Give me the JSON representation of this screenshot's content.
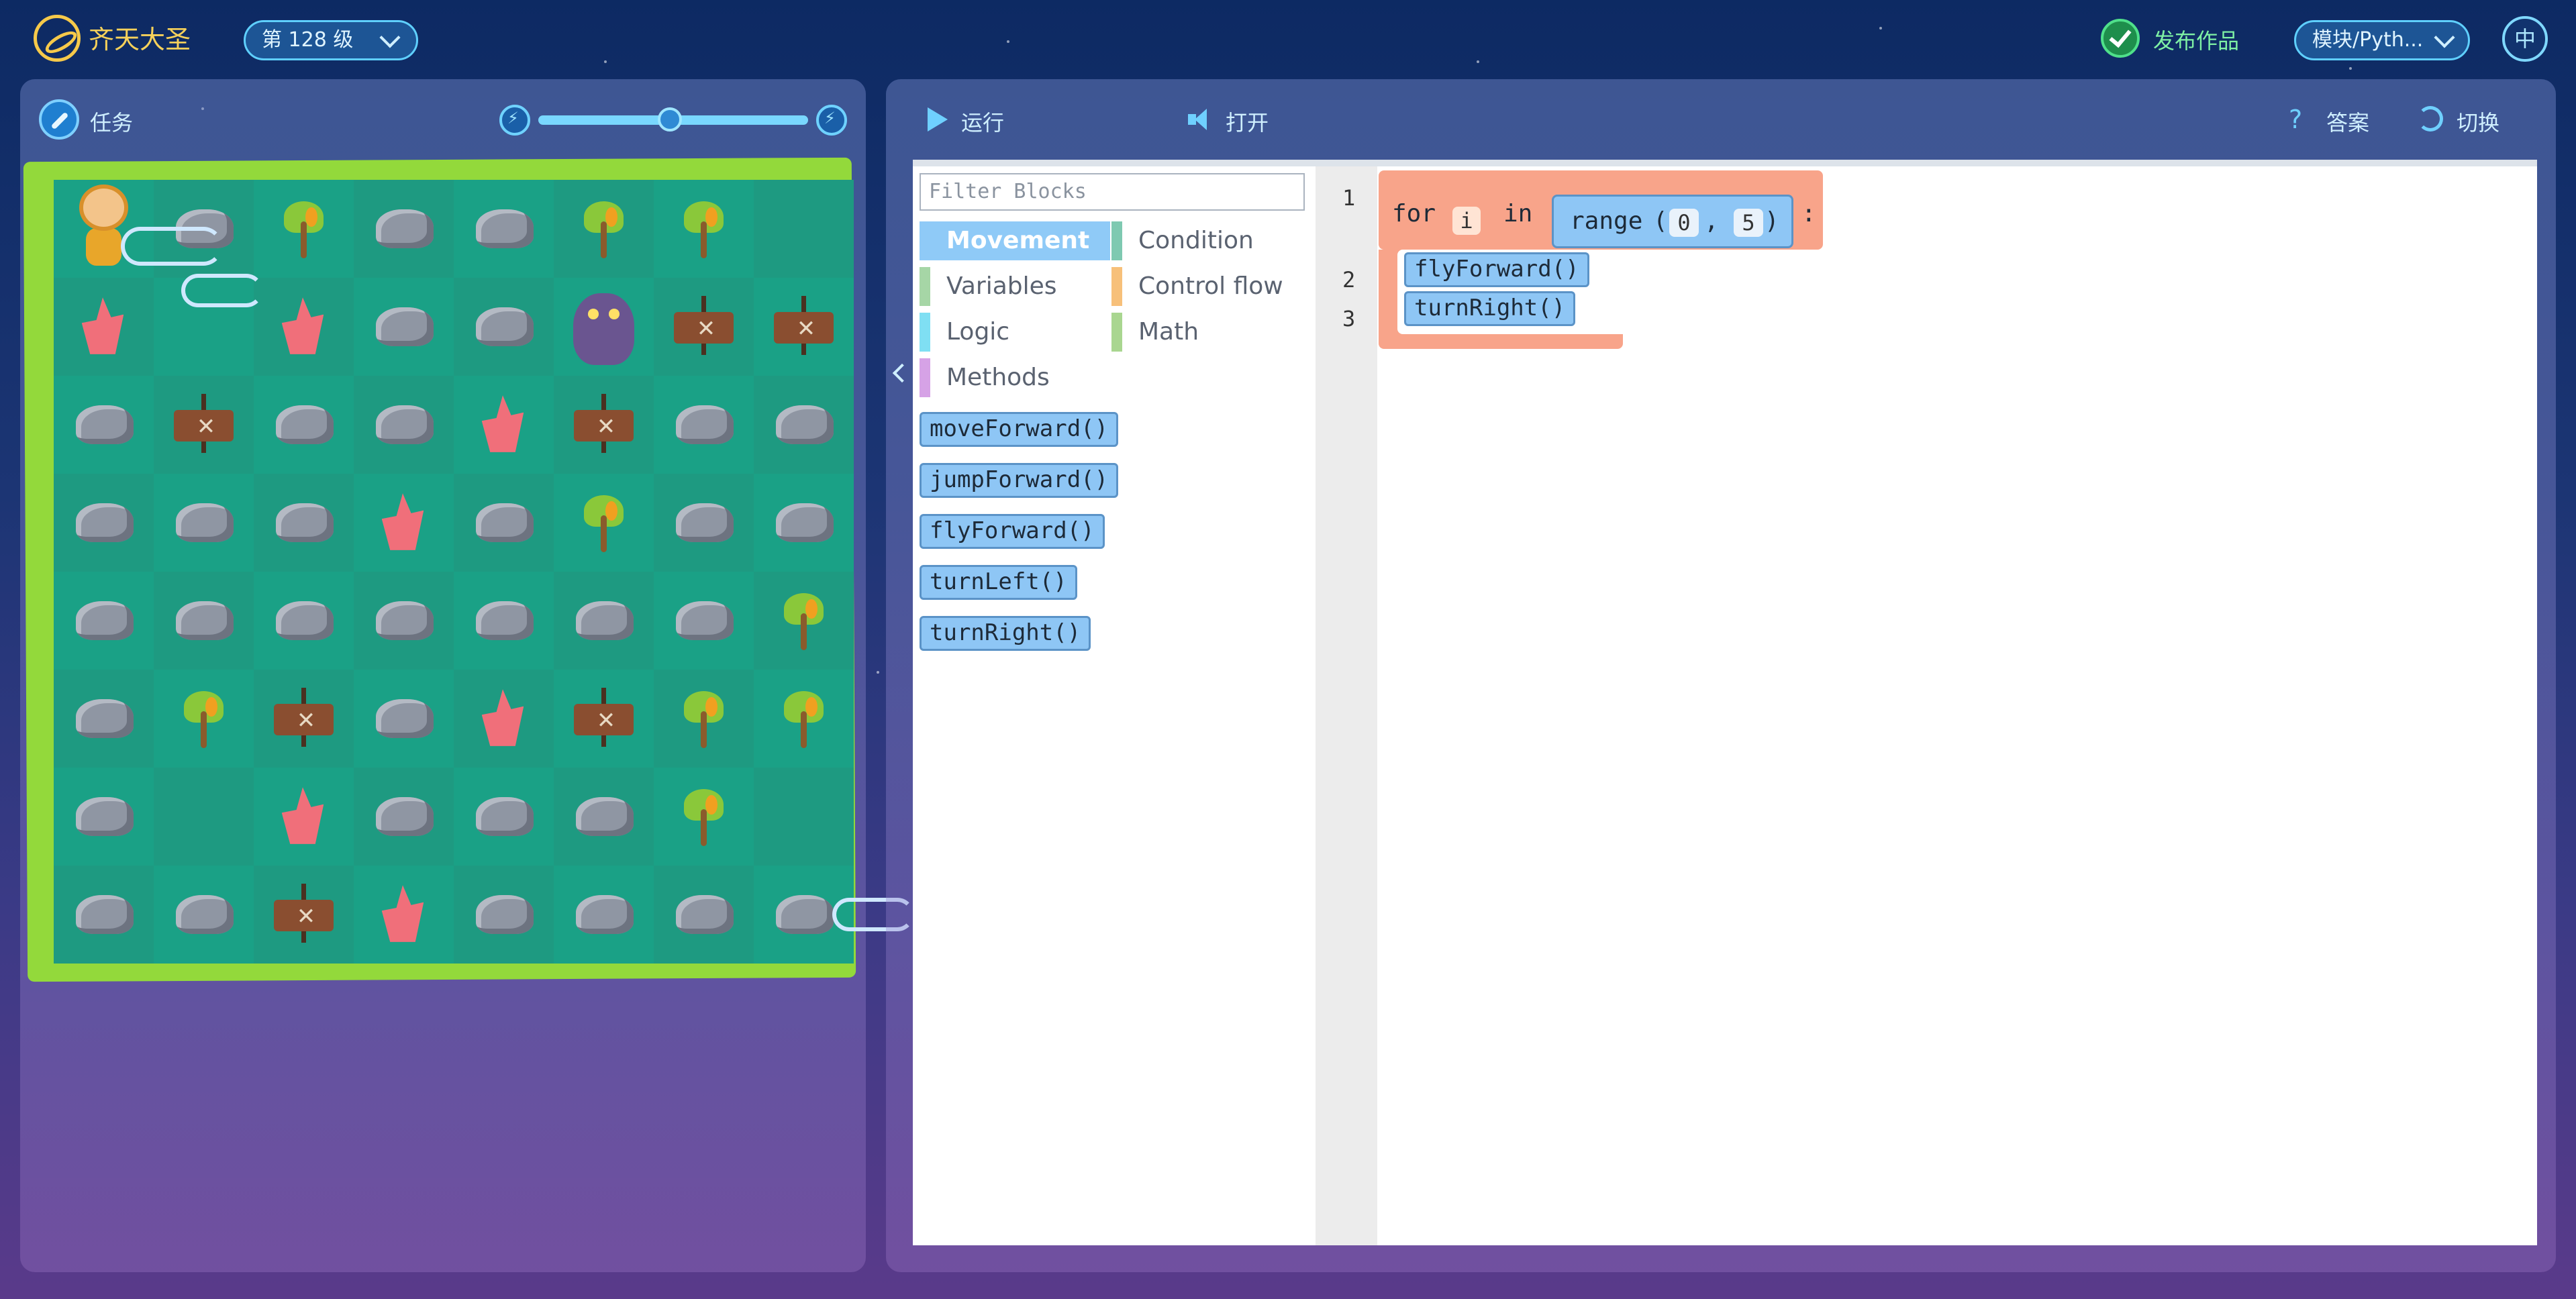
{
  "header": {
    "app_title": "齐天大圣",
    "level_selector": "第 128 级",
    "publish_label": "发布作品",
    "mode_selector": "模块/Pyth...",
    "language_button": "中"
  },
  "left_panel": {
    "task_label": "任务",
    "speed_slider_value": 0.48
  },
  "right_panel": {
    "run_label": "运行",
    "open_label": "打开",
    "answer_label": "答案",
    "switch_label": "切换"
  },
  "toolbox": {
    "filter_placeholder": "Filter Blocks",
    "categories": [
      {
        "label": "Movement",
        "color": "#8fcaf7",
        "selected": true
      },
      {
        "label": "Condition",
        "color": "#7ec9b1"
      },
      {
        "label": "Variables",
        "color": "#a6d6a6"
      },
      {
        "label": "Control flow",
        "color": "#f7c07a"
      },
      {
        "label": "Logic",
        "color": "#7fdff3"
      },
      {
        "label": "Math",
        "color": "#a9d690"
      },
      {
        "label": "Methods",
        "color": "#d6a2e6"
      }
    ],
    "blocks": [
      "moveForward()",
      "jumpForward()",
      "flyForward()",
      "turnLeft()",
      "turnRight()"
    ]
  },
  "code": {
    "line_numbers": [
      "1",
      "2",
      "3"
    ],
    "for_keyword": "for",
    "loop_var": "i",
    "in_keyword": "in",
    "range_name": "range",
    "range_open": "(",
    "range_start": "0",
    "range_comma": ",",
    "range_end": "5",
    "range_close": ")",
    "colon": ":",
    "body": [
      "flyForward()",
      "turnRight()"
    ]
  },
  "colors": {
    "accent": "#5fd0ff",
    "title_gold": "#f6d15a",
    "publish_green": "#7ef0a4",
    "for_block": "#f8a48a",
    "method_block": "#8ec6f5"
  },
  "board": {
    "rows": [
      [
        "hero",
        "rock",
        "palm",
        "rock",
        "rock",
        "palm",
        "palm",
        "empty"
      ],
      [
        "crystal",
        "empty",
        "crystal",
        "rock",
        "rock",
        "monster",
        "sign",
        "sign"
      ],
      [
        "rock",
        "sign",
        "rock",
        "rock",
        "crystal",
        "sign",
        "rock",
        "rock"
      ],
      [
        "rock",
        "rock",
        "rock",
        "crystal",
        "rock",
        "palm",
        "rock",
        "rock"
      ],
      [
        "rock",
        "rock",
        "rock",
        "rock",
        "rock",
        "rock",
        "rock",
        "palm"
      ],
      [
        "rock",
        "palm",
        "sign",
        "rock",
        "crystal",
        "sign",
        "palm",
        "palm"
      ],
      [
        "rock",
        "empty",
        "crystal",
        "rock",
        "rock",
        "rock",
        "palm",
        "empty"
      ],
      [
        "rock",
        "rock",
        "sign",
        "crystal",
        "rock",
        "rock",
        "rock",
        "rock"
      ]
    ]
  }
}
